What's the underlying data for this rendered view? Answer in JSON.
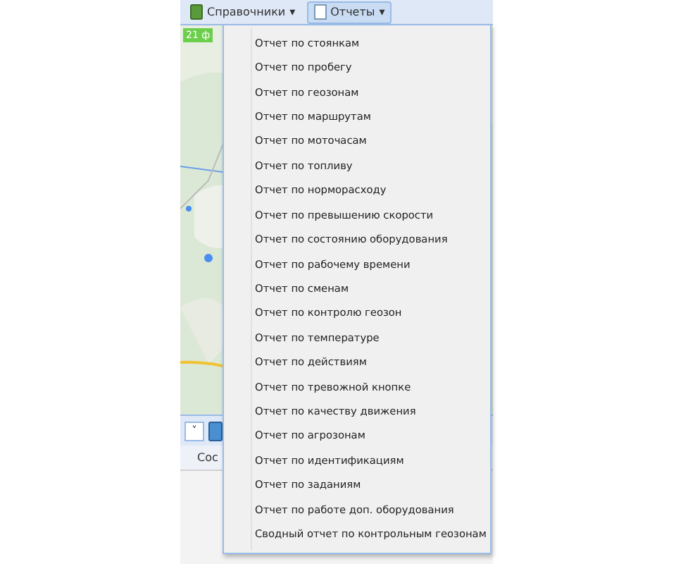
{
  "toolbar": {
    "buttons": [
      {
        "label": "Справочники",
        "caret": "▾",
        "selected": false
      },
      {
        "label": "Отчеты",
        "caret": "▾",
        "selected": true
      }
    ]
  },
  "map": {
    "kind": "picture",
    "strip_label": "21 ф"
  },
  "lower_toolbar": {
    "dropdown_caret": "˅"
  },
  "grid": {
    "column_1": "Сос"
  },
  "menu": {
    "items": [
      {
        "label": "Отчет по стоянкам"
      },
      {
        "label": "Отчет по пробегу"
      },
      {
        "label": "Отчет по геозонам"
      },
      {
        "label": "Отчет по маршрутам"
      },
      {
        "label": "Отчет по моточасам"
      },
      {
        "label": "Отчет по топливу"
      },
      {
        "label": "Отчет по норморасходу"
      },
      {
        "label": "Отчет по превышению скорости"
      },
      {
        "label": "Отчет по состоянию оборудования"
      },
      {
        "label": "Отчет по рабочему времени"
      },
      {
        "label": "Отчет по сменам"
      },
      {
        "label": "Отчет по контролю геозон"
      },
      {
        "label": "Отчет по температуре"
      },
      {
        "label": "Отчет по действиям"
      },
      {
        "label": "Отчет по тревожной кнопке"
      },
      {
        "label": "Отчет по качеству движения"
      },
      {
        "label": "Отчет по агрозонам"
      },
      {
        "label": "Отчет по идентификациям"
      },
      {
        "label": "Отчет по заданиям"
      },
      {
        "label": "Отчет по работе доп. оборудования"
      },
      {
        "label": "Сводный отчет по контрольным геозонам"
      }
    ]
  }
}
